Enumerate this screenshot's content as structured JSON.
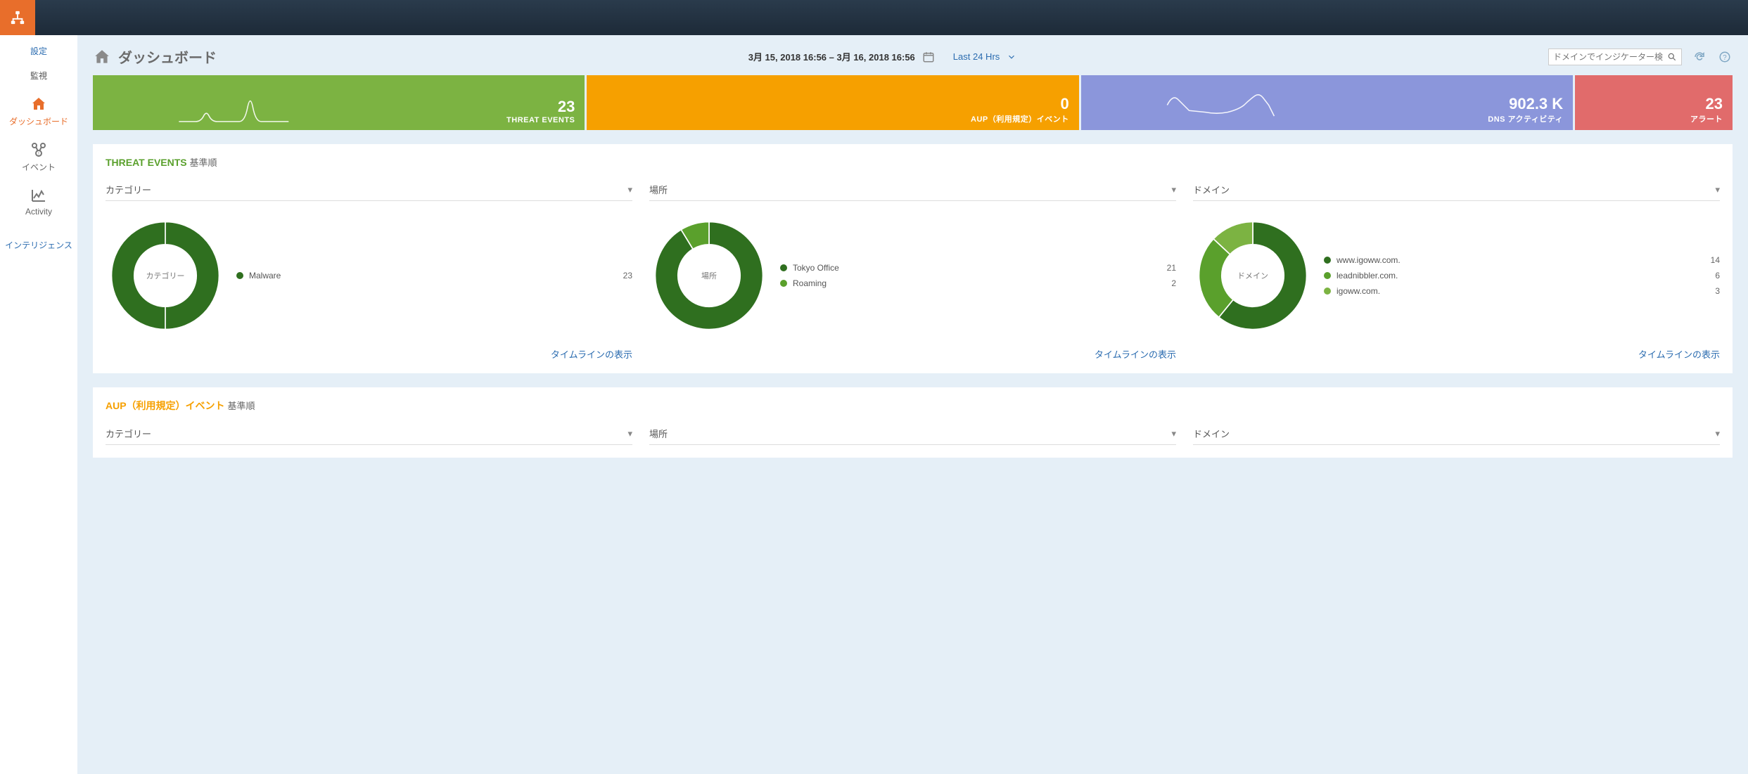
{
  "sidebar": {
    "settings": "設定",
    "monitor": "監視",
    "dashboard": "ダッシュボード",
    "events": "イベント",
    "activity": "Activity",
    "intelligence": "インテリジェンス"
  },
  "header": {
    "title": "ダッシュボード",
    "date_range": "3月 15, 2018 16:56 – 3月 16, 2018 16:56",
    "quick_range": "Last 24 Hrs",
    "search_placeholder": "ドメインでインジケーター検索"
  },
  "tiles": {
    "threat": {
      "value": "23",
      "label": "THREAT EVENTS"
    },
    "aup": {
      "value": "0",
      "label": "AUP（利用規定）イベント"
    },
    "dns": {
      "value": "902.3 K",
      "label": "DNS アクティビティ"
    },
    "alert": {
      "value": "23",
      "label": "アラート"
    }
  },
  "threat_panel": {
    "title_hi": "THREAT EVENTS",
    "title_sub": "基準順",
    "timeline_link": "タイムラインの表示",
    "category": {
      "head": "カテゴリー",
      "center": "カテゴリー"
    },
    "location": {
      "head": "場所",
      "center": "場所"
    },
    "domain": {
      "head": "ドメイン",
      "center": "ドメイン"
    }
  },
  "aup_panel": {
    "title_hi": "AUP（利用規定）イベント",
    "title_sub": "基準順",
    "category_head": "カテゴリー",
    "location_head": "場所",
    "domain_head": "ドメイン"
  },
  "chart_data": [
    {
      "id": "threat_category",
      "type": "pie",
      "title": "カテゴリー",
      "series": [
        {
          "name": "Malware",
          "value": 23,
          "color": "#2f6f1f"
        }
      ]
    },
    {
      "id": "threat_location",
      "type": "pie",
      "title": "場所",
      "series": [
        {
          "name": "Tokyo Office",
          "value": 21,
          "color": "#2f6f1f"
        },
        {
          "name": "Roaming",
          "value": 2,
          "color": "#5aa02c"
        }
      ]
    },
    {
      "id": "threat_domain",
      "type": "pie",
      "title": "ドメイン",
      "series": [
        {
          "name": "www.igoww.com.",
          "value": 14,
          "color": "#2f6f1f"
        },
        {
          "name": "leadnibbler.com.",
          "value": 6,
          "color": "#5aa02c"
        },
        {
          "name": "igoww.com.",
          "value": 3,
          "color": "#7cb342"
        }
      ]
    }
  ]
}
